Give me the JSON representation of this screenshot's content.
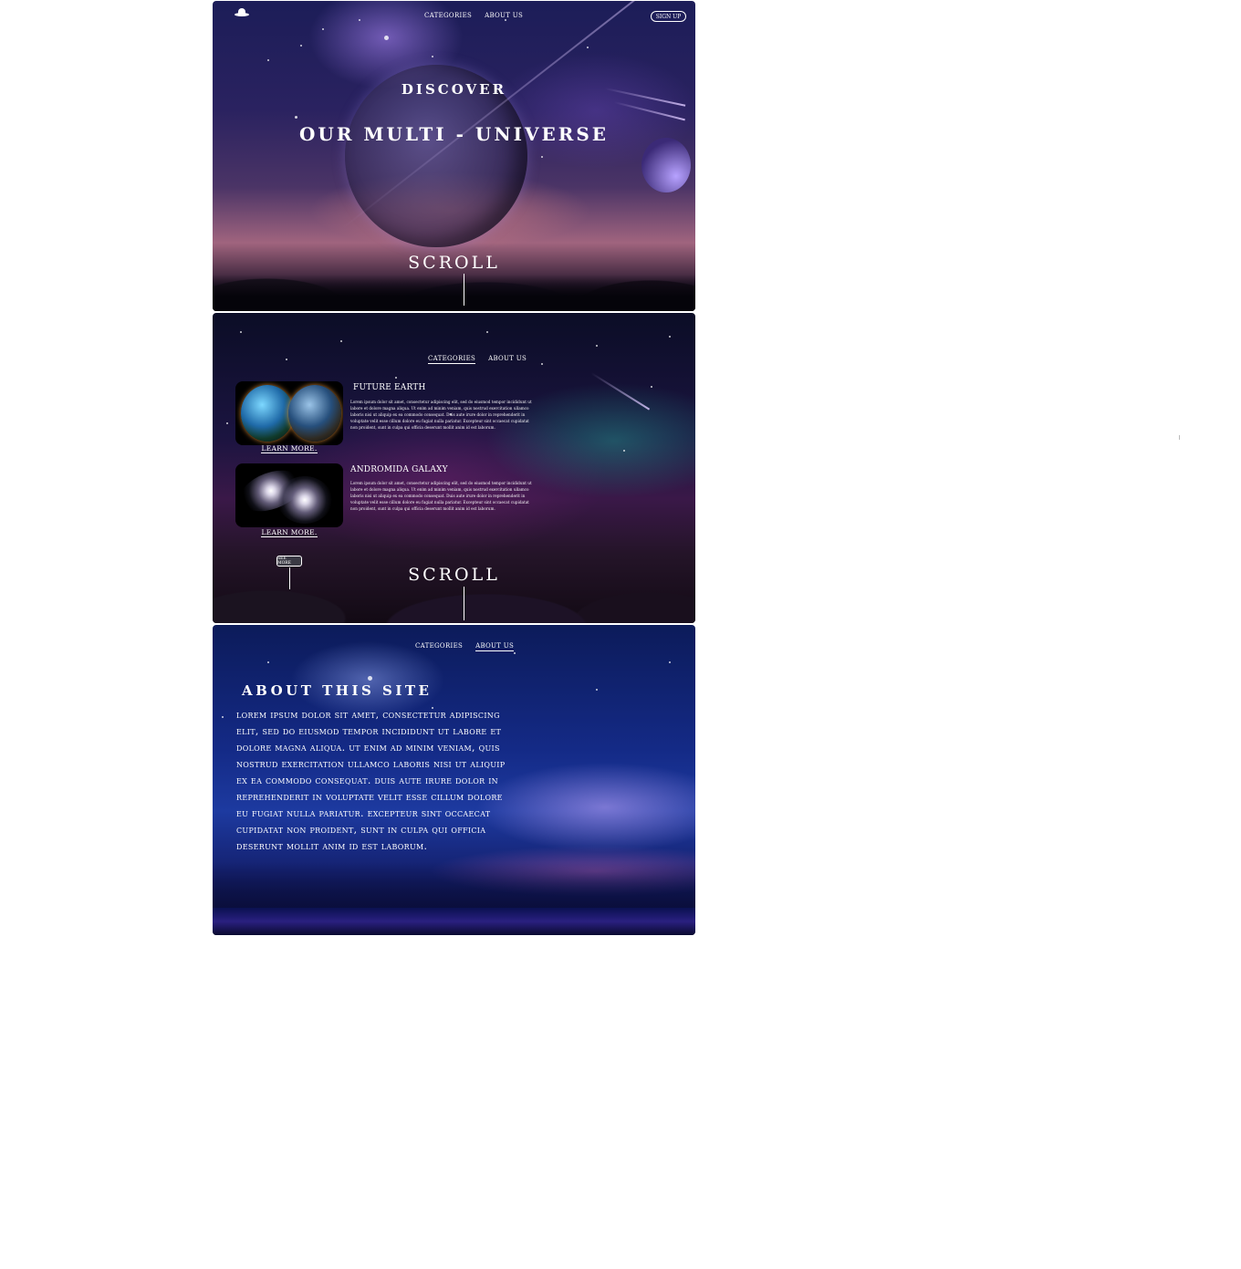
{
  "hero": {
    "nav": {
      "categories": "CATEGORIES",
      "about": "ABOUT US"
    },
    "signup_label": "SIGN UP",
    "kicker": "DISCOVER",
    "title": "OUR MULTI - UNIVERSE",
    "scroll_label": "SCROLL",
    "logo_icon": "ufo-icon"
  },
  "categories": {
    "nav": {
      "categories": "CATEGORIES",
      "about": "ABOUT US",
      "active": "categories"
    },
    "cards": [
      {
        "title": "FUTURE EARTH",
        "body": "Lorem ipsum dolor sit amet, consectetur adipiscing elit, sed do eiusmod tempor incididunt ut labore et dolore magna aliqua. Ut enim ad minim veniam, quis nostrud exercitation ullamco laboris nisi ut aliquip ex ea commodo consequat. Duis aute irure dolor in reprehenderit in voluptate velit esse cillum dolore eu fugiat nulla pariatur. Excepteur sint occaecat cupidatat non proident, sunt in culpa qui officia deserunt mollit anim id est laborum.",
        "link": "LEARN MORE."
      },
      {
        "title": "ANDROMIDA GALAXY",
        "body": "Lorem ipsum dolor sit amet, consectetur adipiscing elit, sed do eiusmod tempor incididunt ut labore et dolore magna aliqua. Ut enim ad minim veniam, quis nostrud exercitation ullamco laboris nisi ut aliquip ex ea commodo consequat. Duis aute irure dolor in reprehenderit in voluptate velit esse cillum dolore eu fugiat nulla pariatur. Excepteur sint occaecat cupidatat non proident, sunt in culpa qui officia deserunt mollit anim id est laborum.",
        "link": "LEARN MORE."
      }
    ],
    "see_more_label": "SEE MORE",
    "scroll_label": "SCROLL"
  },
  "about": {
    "nav": {
      "categories": "CATEGORIES",
      "about": "ABOUT US",
      "active": "about"
    },
    "heading": "ABOUT THIS SITE",
    "body": "Lorem ipsum dolor sit amet, consectetur adipiscing elit, sed do eiusmod tempor incididunt ut labore et dolore magna aliqua. Ut enim ad minim veniam, quis nostrud exercitation ullamco laboris nisi ut aliquip ex ea commodo consequat. Duis aute irure dolor in reprehenderit in voluptate velit esse cillum dolore eu fugiat nulla pariatur. Excepteur sint occaecat cupidatat non proident, sunt in culpa qui officia deserunt mollit anim id est laborum."
  },
  "colors": {
    "page_background": "#ffffff",
    "text": "#ffffff",
    "hero_sky": "#2a2260",
    "categories_sky": "#1b1440",
    "about_sky": "#142a86"
  }
}
